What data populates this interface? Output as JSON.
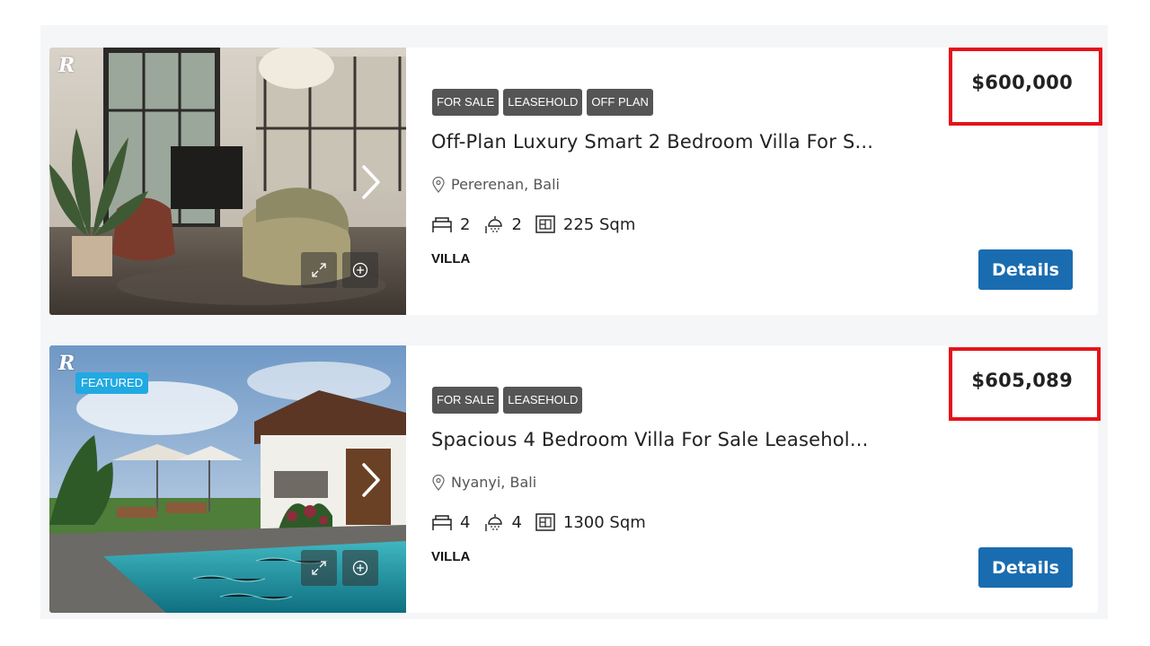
{
  "listings": [
    {
      "tags": [
        "FOR SALE",
        "LEASEHOLD",
        "OFF PLAN"
      ],
      "title": "Off-Plan Luxury Smart 2 Bedroom Villa For S...",
      "location": "Pererenan, Bali",
      "bedrooms": "2",
      "bathrooms": "2",
      "area": "225 Sqm",
      "type": "VILLA",
      "price": "$600,000",
      "button_label": "Details",
      "logo_text": "R",
      "photo_scene": "interior-living-room"
    },
    {
      "featured_label": "FEATURED",
      "tags": [
        "FOR SALE",
        "LEASEHOLD"
      ],
      "title": "Spacious 4 Bedroom Villa For Sale Leasehol...",
      "location": "Nyanyi, Bali",
      "bedrooms": "4",
      "bathrooms": "4",
      "area": "1300 Sqm",
      "type": "VILLA",
      "price": "$605,089",
      "button_label": "Details",
      "logo_text": "R",
      "photo_scene": "villa-pool-exterior"
    }
  ],
  "colors": {
    "tag_bg": "#555555",
    "featured_bg": "#21a9e1",
    "button_bg": "#1a6cb0",
    "highlight_border": "#e4131b",
    "list_bg": "#f4f6f8"
  },
  "icons": [
    "bed-icon",
    "shower-icon",
    "floorplan-icon",
    "map-pin-icon",
    "expand-icon",
    "plus-circle-icon",
    "chevron-right-icon"
  ]
}
